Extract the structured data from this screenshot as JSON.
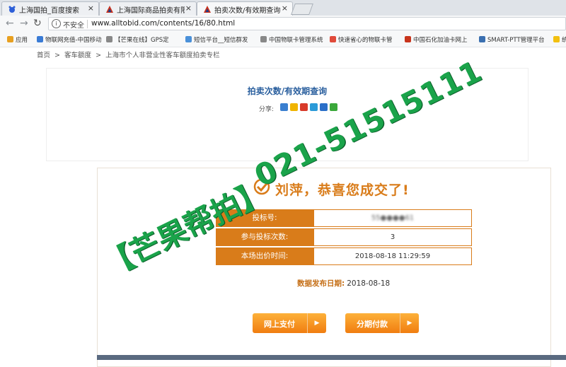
{
  "browser": {
    "tabs": [
      {
        "title": "上海国拍_百度搜索",
        "close": "×"
      },
      {
        "title": "上海国际商品拍卖有限公",
        "close": "×"
      },
      {
        "title": "拍卖次数/有效期查询-上",
        "close": "×"
      }
    ],
    "address": {
      "security_label": "不安全",
      "url": "www.alltobid.com/contents/16/80.html"
    },
    "bookmarks": [
      {
        "label": "应用",
        "icon": "apps-icon",
        "color": "#e8a020"
      },
      {
        "label": "物联网充值-中国移动",
        "icon": "globe-icon",
        "color": "#3a7bd5"
      },
      {
        "label": "【芒果在线】GPS定",
        "icon": "page-icon",
        "color": "#888888"
      },
      {
        "label": "短信平台__短信群发",
        "icon": "sms-icon",
        "color": "#4a90d9"
      },
      {
        "label": "中国物联卡管理系统",
        "icon": "page-icon",
        "color": "#888888"
      },
      {
        "label": "快速省心的物联卡管",
        "icon": "chrome-icon",
        "color": "#e04a3a"
      },
      {
        "label": "中国石化加油卡网上",
        "icon": "sinopec-icon",
        "color": "#c8341c"
      },
      {
        "label": "SMART-PTT管理平台",
        "icon": "smart-icon",
        "color": "#3a6fb0"
      },
      {
        "label": "统",
        "icon": "yellow-icon",
        "color": "#f2c010"
      }
    ]
  },
  "breadcrumb": [
    "首页",
    ">",
    "客车额度",
    ">",
    "上海市个人非营业性客车额度拍卖专栏"
  ],
  "page": {
    "title": "拍卖次数/有效期查询",
    "share_label": "分享:",
    "share_icons": [
      {
        "name": "share-more-icon",
        "color": "#3a7fd0"
      },
      {
        "name": "share-qzone-icon",
        "color": "#f0b400"
      },
      {
        "name": "share-weibo-icon",
        "color": "#d83a2a"
      },
      {
        "name": "share-tencent-icon",
        "color": "#2a9ad8"
      },
      {
        "name": "share-renren-icon",
        "color": "#2a6fc8"
      },
      {
        "name": "share-wechat-icon",
        "color": "#3aa83a"
      }
    ]
  },
  "result": {
    "congrats": "刘萍，恭喜您成交了!",
    "rows": [
      {
        "label": "投标号:",
        "value": "55●●●●61"
      },
      {
        "label": "参与投标次数:",
        "value": "3"
      },
      {
        "label": "本场出价时间:",
        "value": "2018-08-18 11:29:59"
      }
    ],
    "publish_label": "数据发布日期:",
    "publish_date": "2018-08-18",
    "pay_online": "网上支付",
    "pay_installment": "分期付款"
  },
  "watermark": {
    "text_a": "【芒果帮拍】",
    "text_b": "021-51515111"
  },
  "colors": {
    "accent": "#d97c1a",
    "title_blue": "#2a5f9e",
    "watermark_green": "#1aa34a"
  }
}
